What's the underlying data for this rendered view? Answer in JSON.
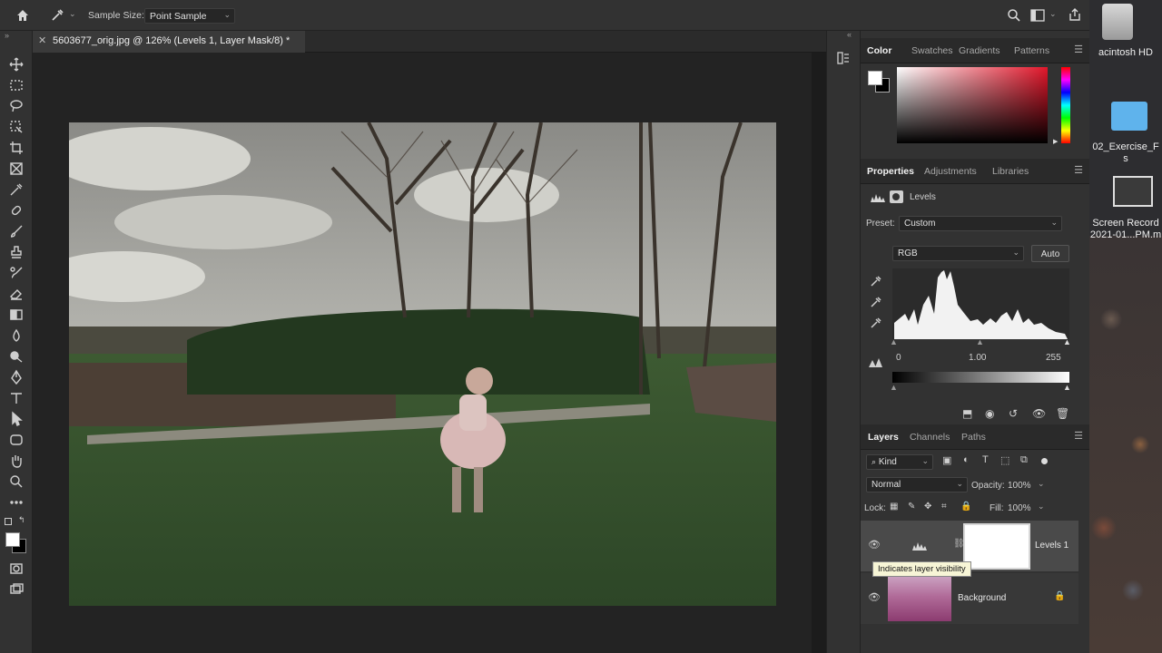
{
  "options_bar": {
    "home_icon": "home-icon",
    "tool_icon": "eyedropper-icon",
    "sample_size_label": "Sample Size:",
    "sample_size_value": "Point Sample"
  },
  "document": {
    "tab_title": "5603677_orig.jpg @ 126% (Levels 1, Layer Mask/8) *"
  },
  "color_panel": {
    "tabs": [
      "Color",
      "Swatches",
      "Gradients",
      "Patterns"
    ]
  },
  "properties_panel": {
    "tabs": [
      "Properties",
      "Adjustments",
      "Libraries"
    ],
    "type_label": "Levels",
    "preset_label": "Preset:",
    "preset_value": "Custom",
    "channel_value": "RGB",
    "auto_label": "Auto",
    "input_black": "0",
    "input_gamma": "1.00",
    "input_white": "255"
  },
  "layers_panel": {
    "tabs": [
      "Layers",
      "Channels",
      "Paths"
    ],
    "filter_kind": "Kind",
    "blend_mode": "Normal",
    "opacity_label": "Opacity:",
    "opacity_value": "100%",
    "lock_label": "Lock:",
    "fill_label": "Fill:",
    "fill_value": "100%",
    "layers": [
      {
        "name": "Levels 1"
      },
      {
        "name": "Background"
      }
    ],
    "tooltip": "Indicates layer visibility"
  },
  "desktop": {
    "drive_label": "acintosh HD",
    "folder_label_1": "02_Exercise_F",
    "folder_label_2": "s",
    "recording_label_1": "Screen Record",
    "recording_label_2": "2021-01...PM.m"
  }
}
